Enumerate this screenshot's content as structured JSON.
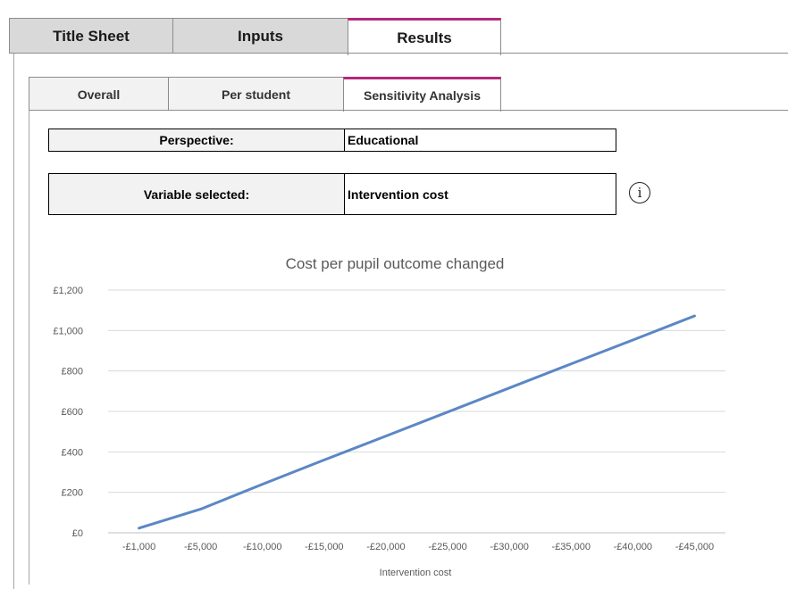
{
  "main_tabs": [
    {
      "label": "Title Sheet"
    },
    {
      "label": "Inputs"
    },
    {
      "label": "Results"
    }
  ],
  "sub_tabs": [
    {
      "label": "Overall"
    },
    {
      "label": "Per student"
    },
    {
      "label": "Sensitivity Analysis"
    }
  ],
  "perspective": {
    "label": "Perspective:",
    "value": "Educational"
  },
  "variable": {
    "label": "Variable selected:",
    "value": "Intervention cost",
    "info_icon": "info-icon"
  },
  "colors": {
    "accent": "#b5287a",
    "line": "#5b87c5"
  },
  "chart_data": {
    "type": "line",
    "title": "Cost per pupil outcome changed",
    "xlabel": "Intervention cost",
    "ylabel": "",
    "categories": [
      "-£1,000",
      "-£5,000",
      "-£10,000",
      "-£15,000",
      "-£20,000",
      "-£25,000",
      "-£30,000",
      "-£35,000",
      "-£40,000",
      "-£45,000"
    ],
    "values": [
      23,
      117,
      240,
      360,
      478,
      597,
      716,
      835,
      953,
      1072
    ],
    "ylim": [
      0,
      1200
    ],
    "yticks": [
      0,
      200,
      400,
      600,
      800,
      1000,
      1200
    ],
    "ytick_labels": [
      "£0",
      "£200",
      "£400",
      "£600",
      "£800",
      "£1,000",
      "£1,200"
    ],
    "grid": true,
    "legend": "none"
  }
}
